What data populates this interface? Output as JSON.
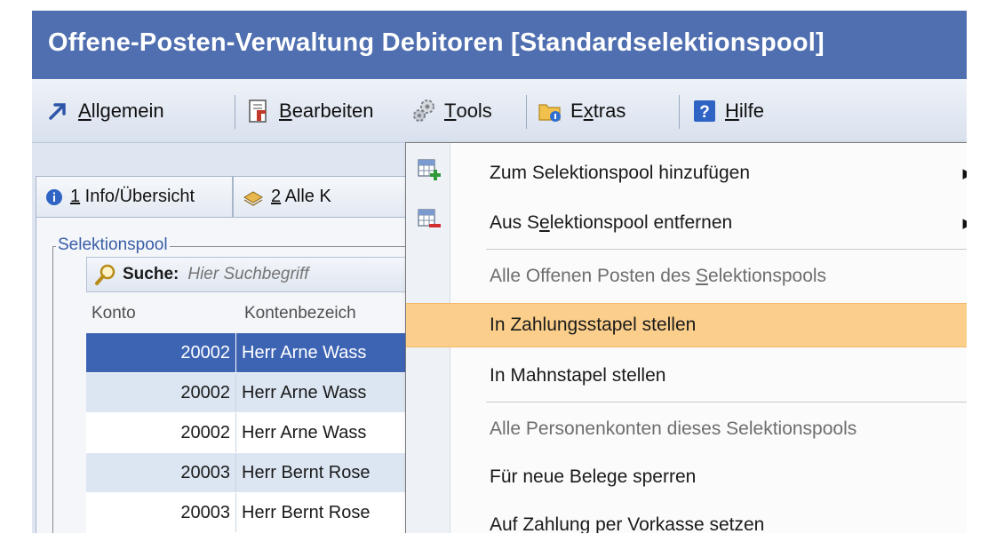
{
  "window": {
    "title": "Offene-Posten-Verwaltung Debitoren [Standardselektionspool]"
  },
  "toolbar": {
    "items": [
      {
        "icon": "arrow-icon",
        "pre": "",
        "key": "A",
        "post": "llgemein"
      },
      {
        "icon": "document-icon",
        "pre": "",
        "key": "B",
        "post": "earbeiten"
      },
      {
        "icon": "gears-icon",
        "pre": "",
        "key": "T",
        "post": "ools"
      },
      {
        "icon": "folder-icon",
        "pre": "E",
        "key": "x",
        "post": "tras"
      },
      {
        "icon": "help-icon",
        "pre": "",
        "key": "H",
        "post": "ilfe"
      }
    ]
  },
  "tabs": [
    {
      "icon": "info-icon",
      "key": "1",
      "label": " Info/Übersicht"
    },
    {
      "icon": "pages-icon",
      "key": "2",
      "label": " Alle K"
    }
  ],
  "group": {
    "label": "Selektionspool"
  },
  "search": {
    "label": "Suche:",
    "placeholder": "Hier Suchbegriff"
  },
  "table": {
    "headers": [
      "Konto",
      "Kontenbezeich"
    ],
    "rows": [
      {
        "konto": "20002",
        "name": "Herr Arne Wass"
      },
      {
        "konto": "20002",
        "name": "Herr Arne Wass"
      },
      {
        "konto": "20002",
        "name": "Herr Arne Wass"
      },
      {
        "konto": "20003",
        "name": "Herr Bernt Rose"
      },
      {
        "konto": "20003",
        "name": "Herr Bernt Rose"
      }
    ]
  },
  "menu": {
    "add": {
      "pre": "Zum Selektionspool hinzufügen",
      "key": "",
      "post": ""
    },
    "remove": {
      "pre": "Aus S",
      "key": "e",
      "post": "lektionspool entfernen"
    },
    "header1": {
      "pre": "Alle Offenen Posten des ",
      "key": "S",
      "post": "elektionspools"
    },
    "zahlung": "In Zahlungsstapel stellen",
    "mahn": "In Mahnstapel stellen",
    "header2": "Alle Personenkonten dieses Selektionspools",
    "sperren": "Für neue Belege sperren",
    "vorkasse": "Auf Zahlung per Vorkasse setzen"
  },
  "colors": {
    "titlebar": "#4f6fb0",
    "selection": "#3d64b3",
    "hover": "#fbcf8b"
  }
}
